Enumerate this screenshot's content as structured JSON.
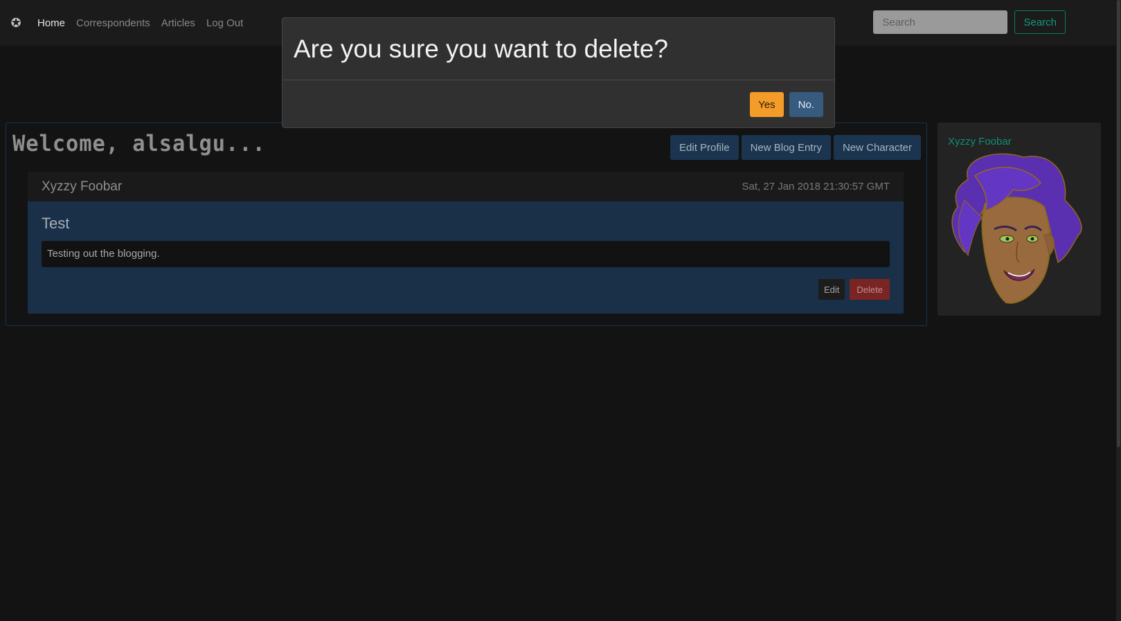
{
  "navbar": {
    "brand_icon": "star-badge-icon",
    "links": [
      {
        "label": "Home",
        "active": true
      },
      {
        "label": "Correspondents",
        "active": false
      },
      {
        "label": "Articles",
        "active": false
      },
      {
        "label": "Log Out",
        "active": false
      }
    ],
    "search": {
      "placeholder": "Search",
      "button_label": "Search"
    }
  },
  "main": {
    "welcome": "Welcome, alsalgu...",
    "actions": {
      "edit_profile": "Edit Profile",
      "new_blog_entry": "New Blog Entry",
      "new_character": "New Character"
    },
    "blog_entry": {
      "author": "Xyzzy Foobar",
      "date": "Sat, 27 Jan 2018 21:30:57 GMT",
      "title": "Test",
      "body": "Testing out the blogging.",
      "edit_label": "Edit",
      "delete_label": "Delete"
    }
  },
  "sidebar": {
    "character_name": "Xyzzy Foobar",
    "portrait_icon": "character-portrait-icon"
  },
  "modal": {
    "title": "Are you sure you want to delete?",
    "yes_label": "Yes",
    "no_label": "No."
  },
  "colors": {
    "accent_orange": "#f39c2a",
    "primary_blue": "#375a7f",
    "link_teal": "#119a7d",
    "danger_red": "#7a2424"
  }
}
